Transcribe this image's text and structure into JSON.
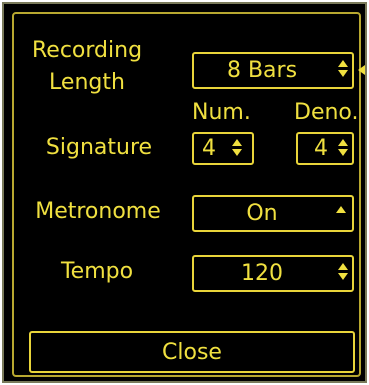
{
  "dialog": {
    "recording_length": {
      "label_line1": "Recording",
      "label_line2": "Length",
      "value": "8 Bars"
    },
    "signature": {
      "label": "Signature",
      "num_label": "Num.",
      "deno_label": "Deno.",
      "num_value": "4",
      "deno_value": "4"
    },
    "metronome": {
      "label": "Metronome",
      "value": "On"
    },
    "tempo": {
      "label": "Tempo",
      "value": "120"
    },
    "close_label": "Close"
  },
  "icons": {
    "spinner": "spinner-arrows-icon",
    "dropdown": "dropdown-up-arrow-icon",
    "pointer": "left-pointer-icon"
  },
  "colors": {
    "background": "#000000",
    "text": "#f0e040",
    "border": "#e8d43a"
  }
}
